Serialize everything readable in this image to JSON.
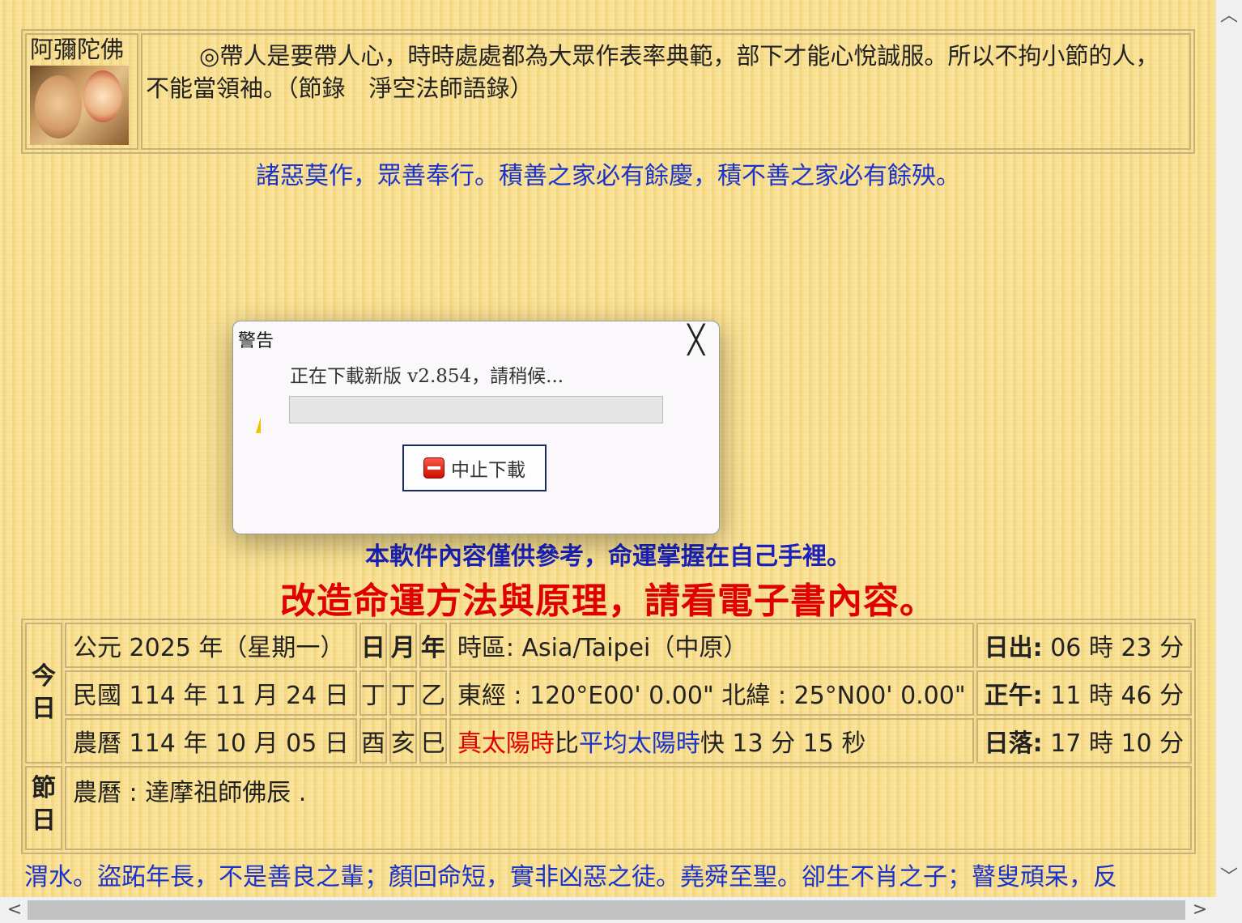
{
  "quote": {
    "buddha_name": "阿彌陀佛",
    "mark": "◎",
    "text": "帶人是要帶人心，時時處處都為大眾作表率典範，部下才能心悅誠服。所以不拘小節的人，不能當領袖。（節錄　淨空法師語錄）"
  },
  "mottos": {
    "line1": "諸惡莫作，眾善奉行。積善之家必有餘慶，積不善之家必有餘殃。",
    "line2": "本軟件內容僅供參考，命運掌握在自己手裡。",
    "line3": "改造命運方法與原理，請看電子書內容。"
  },
  "today": {
    "label": "今日",
    "gregorian": "公元 2025 年（星期一）",
    "roc": "民國 114 年 11 月 24 日",
    "lunar": "農曆 114 年 10 月 05 日",
    "headers": {
      "day": "日",
      "month": "月",
      "year": "年"
    },
    "stems": {
      "day": "丁",
      "month": "丁",
      "year": "乙"
    },
    "branches": {
      "day": "酉",
      "month": "亥",
      "year": "巳"
    },
    "timezone": "時區: Asia/Taipei（中原）",
    "coords": "東經 : 120°E00' 0.00\" 北緯 : 25°N00' 0.00\"",
    "true_solar": "真太陽時",
    "compare_mid": "比",
    "mean_solar": "平均太陽時",
    "diff": "快 13 分 15 秒",
    "sunrise_label": "日出:",
    "sunrise": " 06 時 23 分",
    "noon_label": "正午:",
    "noon": " 11 時 46 分",
    "sunset_label": "日落:",
    "sunset": " 17 時 10 分"
  },
  "festival": {
    "label": "節日",
    "text": "農曆 : 達摩祖師佛辰 ."
  },
  "scroll_text": "渭水。盜跖年長，不是善良之輩；顏回命短，實非凶惡之徒。堯舜至聖。卻生不肖之子；瞽叟頑呆，反",
  "dialog": {
    "title": "警告",
    "close_glyph": "╳",
    "message": "正在下載新版 v2.854，請稍候...",
    "progress": 0,
    "button_label": "中止下載"
  },
  "scrollbar": {
    "up": "︿",
    "down": "﹀",
    "left": "<",
    "right": ">"
  }
}
